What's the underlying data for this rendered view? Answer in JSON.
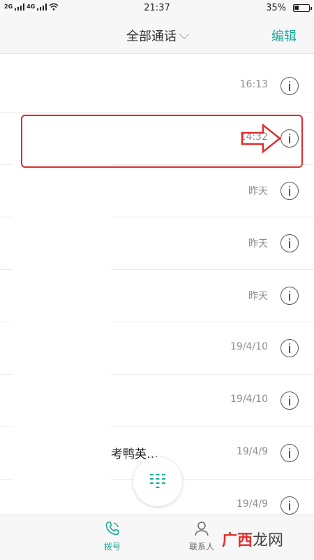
{
  "status_bar": {
    "network1": "2G",
    "network2": "4G",
    "time": "21:37",
    "battery": "35%",
    "battery_level": 0.35
  },
  "header": {
    "title": "全部通话",
    "edit_label": "编辑"
  },
  "calls": [
    {
      "name": "",
      "time": "16:13"
    },
    {
      "name": "",
      "time": "14:32"
    },
    {
      "name": "",
      "time": "昨天"
    },
    {
      "name": "",
      "time": "昨天"
    },
    {
      "name": "",
      "time": "昨天"
    },
    {
      "name": "",
      "time": "19/4/10"
    },
    {
      "name": "",
      "time": "19/4/10"
    },
    {
      "name": "考鸭英…",
      "time": "19/4/9"
    },
    {
      "name": "",
      "time": "19/4/9"
    }
  ],
  "bottom_tabs": {
    "dial": "拨号",
    "contacts": "联系人"
  },
  "watermark": {
    "text": "龙网",
    "logo_text": "广西"
  },
  "colors": {
    "accent": "#1aa89a",
    "highlight": "#e02d2d"
  }
}
